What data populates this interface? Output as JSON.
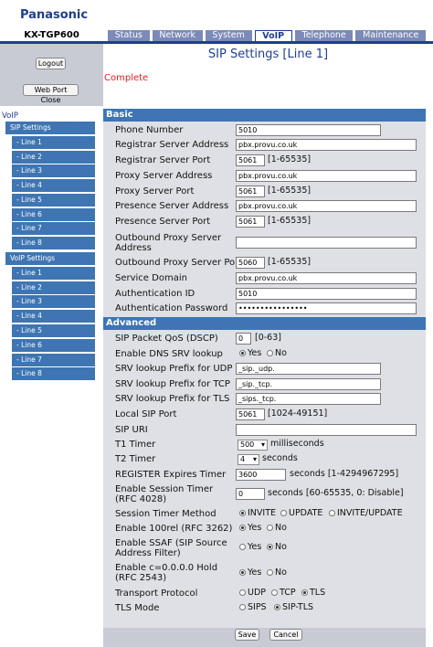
{
  "header": {
    "brand": "Panasonic",
    "model": "KX-TGP600"
  },
  "tabs": [
    "Status",
    "Network",
    "System",
    "VoIP",
    "Telephone",
    "Maintenance"
  ],
  "active_tab": "VoIP",
  "sidebar": {
    "logout": "Logout",
    "web_port_close": "Web Port Close",
    "section": "VoIP",
    "sip_settings": "SIP Settings",
    "sip_lines": [
      "- Line 1",
      "- Line 2",
      "- Line 3",
      "- Line 4",
      "- Line 5",
      "- Line 6",
      "- Line 7",
      "- Line 8"
    ],
    "voip_settings": "VoIP Settings",
    "voip_lines": [
      "- Line 1",
      "- Line 2",
      "- Line 3",
      "- Line 4",
      "- Line 5",
      "- Line 6",
      "- Line 7",
      "- Line 8"
    ]
  },
  "page": {
    "title": "SIP Settings [Line 1]",
    "status": "Complete"
  },
  "basic": {
    "title": "Basic",
    "phone_number": {
      "label": "Phone Number",
      "value": "5010"
    },
    "registrar_addr": {
      "label": "Registrar Server Address",
      "value": "pbx.provu.co.uk"
    },
    "registrar_port": {
      "label": "Registrar Server Port",
      "value": "5061",
      "range": "[1-65535]"
    },
    "proxy_addr": {
      "label": "Proxy Server Address",
      "value": "pbx.provu.co.uk"
    },
    "proxy_port": {
      "label": "Proxy Server Port",
      "value": "5061",
      "range": "[1-65535]"
    },
    "presence_addr": {
      "label": "Presence Server Address",
      "value": "pbx.provu.co.uk"
    },
    "presence_port": {
      "label": "Presence Server Port",
      "value": "5061",
      "range": "[1-65535]"
    },
    "outbound_addr": {
      "label": "Outbound Proxy Server Address",
      "value": ""
    },
    "outbound_port": {
      "label": "Outbound Proxy Server Port",
      "value": "5060",
      "range": "[1-65535]"
    },
    "service_domain": {
      "label": "Service Domain",
      "value": "pbx.provu.co.uk"
    },
    "auth_id": {
      "label": "Authentication ID",
      "value": "5010"
    },
    "auth_password": {
      "label": "Authentication Password",
      "value": "••••••••••••••••"
    }
  },
  "advanced": {
    "title": "Advanced",
    "dscp": {
      "label": "SIP Packet QoS (DSCP)",
      "value": "0",
      "range": "[0-63]"
    },
    "dns_srv": {
      "label": "Enable DNS SRV lookup",
      "options": [
        "Yes",
        "No"
      ],
      "selected": "Yes"
    },
    "srv_udp": {
      "label": "SRV lookup Prefix for UDP",
      "value": "_sip._udp."
    },
    "srv_tcp": {
      "label": "SRV lookup Prefix for TCP",
      "value": "_sip._tcp."
    },
    "srv_tls": {
      "label": "SRV lookup Prefix for TLS",
      "value": "_sips._tcp."
    },
    "local_port": {
      "label": "Local SIP Port",
      "value": "5061",
      "range": "[1024-49151]"
    },
    "sip_uri": {
      "label": "SIP URI",
      "value": ""
    },
    "t1": {
      "label": "T1 Timer",
      "value": "500",
      "unit": "milliseconds"
    },
    "t2": {
      "label": "T2 Timer",
      "value": "4",
      "unit": "seconds"
    },
    "reg_expires": {
      "label": "REGISTER Expires Timer",
      "value": "3600",
      "unit": "seconds [1-4294967295]"
    },
    "session_timer": {
      "label": "Enable Session Timer (RFC 4028)",
      "value": "0",
      "unit": "seconds [60-65535, 0: Disable]"
    },
    "session_method": {
      "label": "Session Timer Method",
      "options": [
        "INVITE",
        "UPDATE",
        "INVITE/UPDATE"
      ],
      "selected": "INVITE"
    },
    "rel100": {
      "label": "Enable 100rel (RFC 3262)",
      "options": [
        "Yes",
        "No"
      ],
      "selected": "Yes"
    },
    "ssaf": {
      "label": "Enable SSAF (SIP Source Address Filter)",
      "options": [
        "Yes",
        "No"
      ],
      "selected": "No"
    },
    "hold": {
      "label": "Enable c=0.0.0.0 Hold (RFC 2543)",
      "options": [
        "Yes",
        "No"
      ],
      "selected": "Yes"
    },
    "transport": {
      "label": "Transport Protocol",
      "options": [
        "UDP",
        "TCP",
        "TLS"
      ],
      "selected": "TLS"
    },
    "tls_mode": {
      "label": "TLS Mode",
      "options": [
        "SIPS",
        "SIP-TLS"
      ],
      "selected": "SIP-TLS"
    }
  },
  "buttons": {
    "save": "Save",
    "cancel": "Cancel"
  }
}
